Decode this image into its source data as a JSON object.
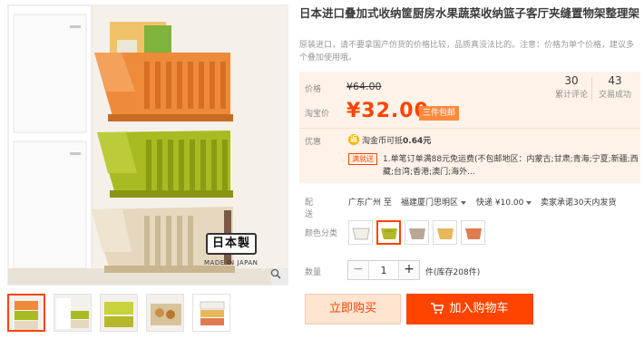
{
  "product": {
    "title": "日本进口叠加式收纳筐厨房水果蔬菜收纳篮子客厅夹缝置物架整理架",
    "subtitle": "原装进口，请不要拿国产仿货的价格比较，品质真没法比的。注意：价格为单个价格，建议多个叠加使用哦。"
  },
  "gallery": {
    "badge_text": "日本製",
    "made_in_text": "MADE IN JAPAN",
    "zoom_icon": "magnifier-icon",
    "thumbnail_count": 5,
    "active_thumbnail": 1
  },
  "price": {
    "label": "价格",
    "original": "¥64.00",
    "taobao_label": "淘宝价",
    "current": "¥32.00",
    "promo_tag": "三件包邮"
  },
  "stats": {
    "reviews_count": "30",
    "reviews_label": "累计评论",
    "sales_count": "43",
    "sales_label": "交易成功"
  },
  "promotions": {
    "label": "优惠",
    "coupon_icon_text": "返",
    "coupon_prefix": "淘金币可抵",
    "coupon_amount": "0.64元",
    "freeship_tag": "满就送",
    "freeship_text": "1.单笔订单满88元免运费(不包邮地区：内蒙古;甘肃;青海;宁夏;新疆;西藏;台湾;香港;澳门;海外..."
  },
  "delivery": {
    "label": "配送",
    "from": "广东广州 至",
    "to": "福建厦门思明区",
    "shipping": "快递 ¥10.00",
    "promise": "卖家承诺30天内发货"
  },
  "variants": {
    "label": "颜色分类",
    "colors": [
      "#f2efe8",
      "#b5b82a",
      "#b8a895",
      "#e8b75a",
      "#e07b4e"
    ],
    "selected_index": 1
  },
  "quantity": {
    "label": "数量",
    "minus": "−",
    "value": "1",
    "plus": "+",
    "stock": "件(库存208件)"
  },
  "actions": {
    "buy_now": "立即购买",
    "add_to_cart": "加入购物车"
  },
  "theme": {
    "accent": "#ff4400",
    "price_bg": "#fff2e8",
    "basket_orange": "#ef8a3a",
    "basket_green": "#a9bb22",
    "basket_beige": "#e6d8bf"
  }
}
